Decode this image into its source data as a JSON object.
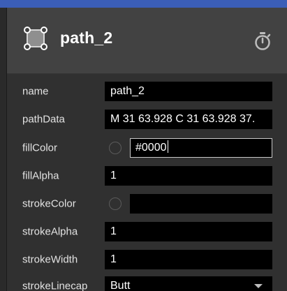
{
  "header": {
    "title": "path_2",
    "icon": "path-node-icon",
    "action_icon": "stopwatch-icon"
  },
  "colors": {
    "top_strip": "#3b5eb7",
    "header_bg": "#424242",
    "panel_bg": "#303030",
    "field_bg": "#000000"
  },
  "properties": {
    "name": {
      "label": "name",
      "value": "path_2"
    },
    "pathData": {
      "label": "pathData",
      "value": "M 31 63.928 C 31 63.928 37."
    },
    "fillColor": {
      "label": "fillColor",
      "value": "#0000"
    },
    "fillAlpha": {
      "label": "fillAlpha",
      "value": "1"
    },
    "strokeColor": {
      "label": "strokeColor",
      "value": ""
    },
    "strokeAlpha": {
      "label": "strokeAlpha",
      "value": "1"
    },
    "strokeWidth": {
      "label": "strokeWidth",
      "value": "1"
    },
    "strokeLinecap": {
      "label": "strokeLinecap",
      "value": "Butt"
    }
  }
}
